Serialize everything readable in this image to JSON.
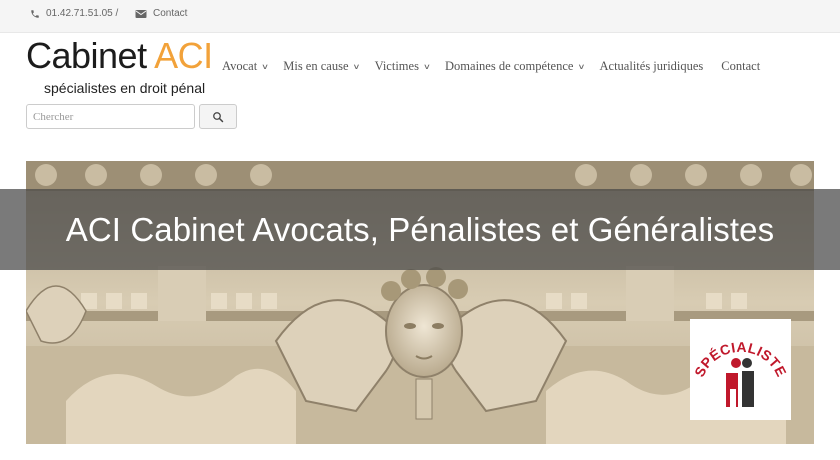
{
  "topbar": {
    "phone": "01.42.71.51.05 /",
    "contact": "Contact"
  },
  "logo": {
    "brand_main": "Cabinet ",
    "brand_accent": "ACI",
    "tagline": "spécialistes en droit pénal"
  },
  "nav": {
    "items": [
      {
        "label": "Avocat",
        "has_dropdown": true
      },
      {
        "label": "Mis en cause",
        "has_dropdown": true
      },
      {
        "label": "Victimes",
        "has_dropdown": true
      },
      {
        "label": "Domaines de compétence",
        "has_dropdown": true
      },
      {
        "label": "Actualités juridiques",
        "has_dropdown": false
      },
      {
        "label": "Contact",
        "has_dropdown": false
      }
    ]
  },
  "search": {
    "placeholder": "Chercher"
  },
  "hero": {
    "title": "ACI Cabinet Avocats, Pénalistes et Généralistes",
    "badge_text": "SPÉCIALISTE"
  },
  "colors": {
    "accent": "#f2a23a",
    "badge_red": "#c0182b",
    "banner_overlay": "rgba(70,70,70,0.72)"
  }
}
